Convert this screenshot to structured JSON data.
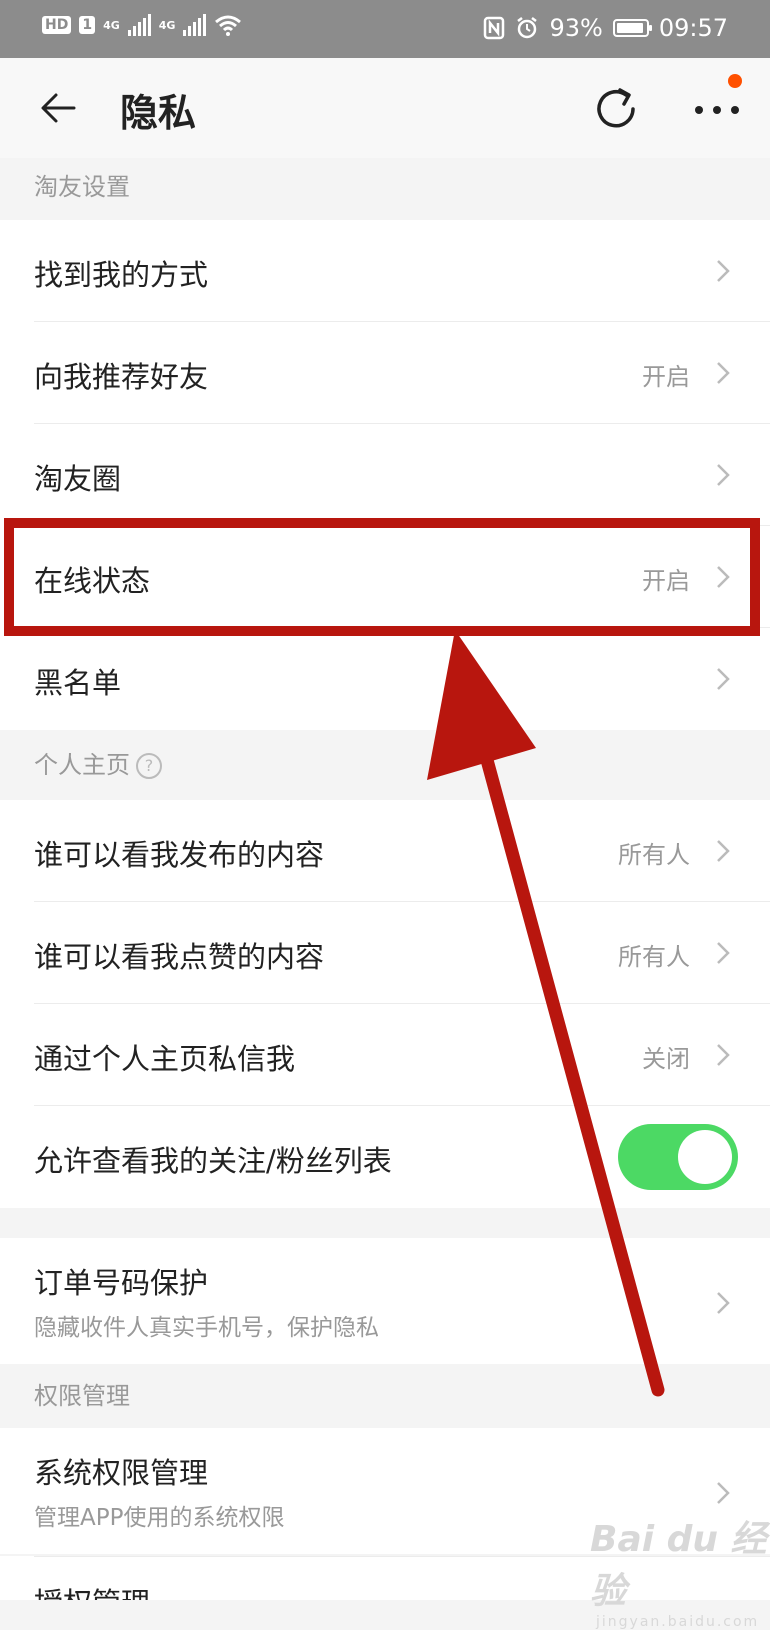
{
  "status_bar": {
    "hd": "HD",
    "sim1": "1",
    "net1": "4G",
    "net2": "4G",
    "battery": "93%",
    "battery_level": 0.93,
    "time": "09:57"
  },
  "header": {
    "title": "隐私",
    "icons": [
      "back-arrow-icon",
      "refresh-icon",
      "more-icon"
    ],
    "badge_color": "#ff5000"
  },
  "sections": {
    "friends": {
      "header": "淘友设置",
      "items": [
        {
          "label": "找到我的方式",
          "value": ""
        },
        {
          "label": "向我推荐好友",
          "value": "开启"
        },
        {
          "label": "淘友圈",
          "value": ""
        },
        {
          "label": "在线状态",
          "value": "开启"
        },
        {
          "label": "黑名单",
          "value": ""
        }
      ]
    },
    "homepage": {
      "header": "个人主页",
      "help_icon": "?",
      "items": [
        {
          "label": "谁可以看我发布的内容",
          "value": "所有人"
        },
        {
          "label": "谁可以看我点赞的内容",
          "value": "所有人"
        },
        {
          "label": "通过个人主页私信我",
          "value": "关闭"
        },
        {
          "label": "允许查看我的关注/粉丝列表",
          "toggle_on": true
        }
      ]
    },
    "order": {
      "label": "订单号码保护",
      "subtitle": "隐藏收件人真实手机号，保护隐私"
    },
    "permissions": {
      "header": "权限管理",
      "items": [
        {
          "label": "系统权限管理",
          "subtitle": "管理APP使用的系统权限"
        },
        {
          "label": "授权管理"
        }
      ]
    }
  },
  "colors": {
    "toggle_on": "#4cd964",
    "annotation": "#b8160e"
  },
  "watermark": {
    "main": "Bai du 经验",
    "sub": "jingyan.baidu.com"
  }
}
